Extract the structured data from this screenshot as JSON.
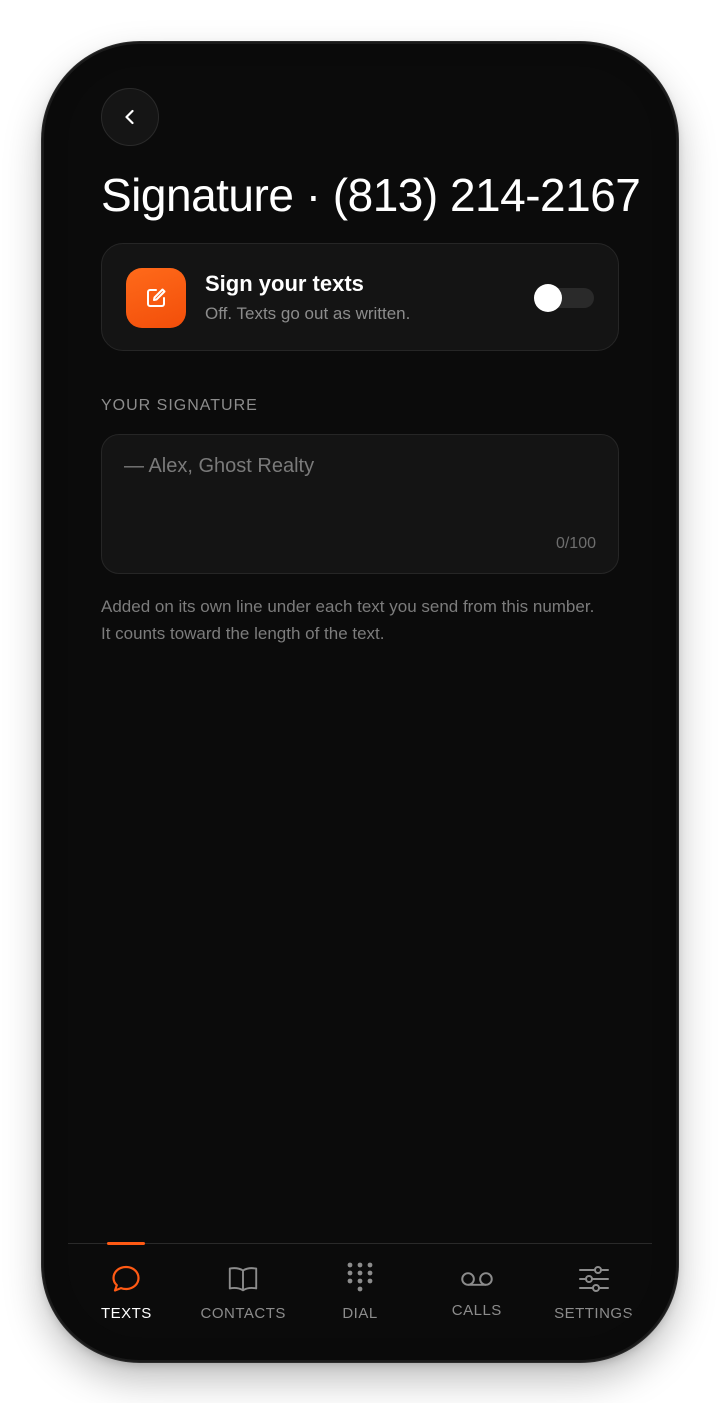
{
  "header": {
    "title": "Signature · (813) 214-2167"
  },
  "toggle_card": {
    "title": "Sign your texts",
    "subtitle": "Off. Texts go out as written.",
    "enabled": false,
    "accent_color": "#ff5a14"
  },
  "signature": {
    "section_label": "YOUR SIGNATURE",
    "value": "",
    "placeholder": "— Alex, Ghost Realty",
    "counter": "0/100",
    "helper_text": "Added on its own line under each text you send from this number. It counts toward the length of the text."
  },
  "tabs": [
    {
      "label": "TEXTS",
      "icon": "chat-bubble-icon",
      "active": true
    },
    {
      "label": "CONTACTS",
      "icon": "book-icon",
      "active": false
    },
    {
      "label": "DIAL",
      "icon": "dialpad-icon",
      "active": false
    },
    {
      "label": "CALLS",
      "icon": "voicemail-icon",
      "active": false
    },
    {
      "label": "SETTINGS",
      "icon": "sliders-icon",
      "active": false
    }
  ]
}
